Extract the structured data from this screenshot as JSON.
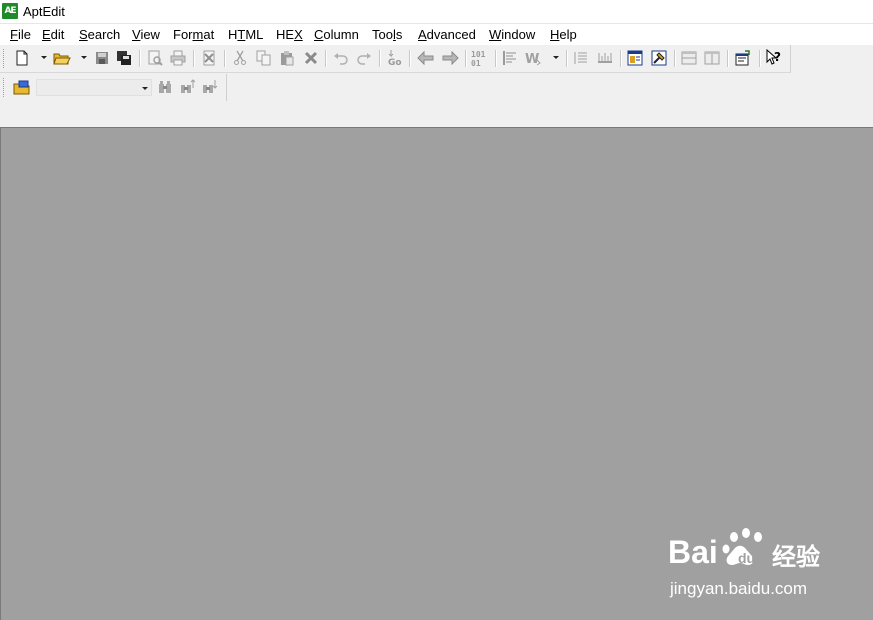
{
  "window": {
    "title": "AptEdit",
    "logo_text": "AE"
  },
  "menubar": {
    "items": [
      {
        "label": "File",
        "accel": "F",
        "rest": "ile"
      },
      {
        "label": "Edit",
        "accel": "E",
        "rest": "dit"
      },
      {
        "label": "Search",
        "accel": "S",
        "rest": "earch"
      },
      {
        "label": "View",
        "accel": "V",
        "rest": "iew"
      },
      {
        "label": "Format",
        "pre": "For",
        "accel": "m",
        "rest": "at"
      },
      {
        "label": "HTML",
        "pre": "H",
        "accel": "T",
        "rest": "ML"
      },
      {
        "label": "HEX",
        "pre": "HE",
        "accel": "X",
        "rest": ""
      },
      {
        "label": "Column",
        "accel": "C",
        "rest": "olumn"
      },
      {
        "label": "Tools",
        "pre": "Too",
        "accel": "l",
        "rest": "s"
      },
      {
        "label": "Advanced",
        "accel": "A",
        "rest": "dvanced"
      },
      {
        "label": "Window",
        "accel": "W",
        "rest": "indow"
      },
      {
        "label": "Help",
        "accel": "H",
        "rest": "elp"
      }
    ]
  },
  "toolbar": {
    "icons": [
      "new-file-icon",
      "open-folder-icon",
      "save-icon",
      "save-all-icon",
      "print-preview-icon",
      "print-icon",
      "close-file-icon",
      "cut-icon",
      "copy-icon",
      "paste-icon",
      "delete-icon",
      "undo-icon",
      "redo-icon",
      "goto-icon",
      "prev-bookmark-icon",
      "next-bookmark-icon",
      "binary-icon",
      "align-left-icon",
      "word-wrap-icon",
      "line-numbers-icon",
      "ruler-icon",
      "html-editor-icon",
      "tool-icon",
      "split-horizontal-icon",
      "split-vertical-icon",
      "properties-icon",
      "context-help-icon"
    ]
  },
  "search_toolbar": {
    "search_value": "",
    "icons": [
      "find-in-files-icon",
      "find-icon",
      "find-prev-icon",
      "find-next-icon"
    ]
  },
  "watermark": {
    "logo": "Bai du 经验",
    "url": "jingyan.baidu.com"
  },
  "colors": {
    "mdi_background": "#a0a0a0",
    "toolbar_background": "#f0f0f0",
    "logo_green": "#1f8a2a"
  }
}
